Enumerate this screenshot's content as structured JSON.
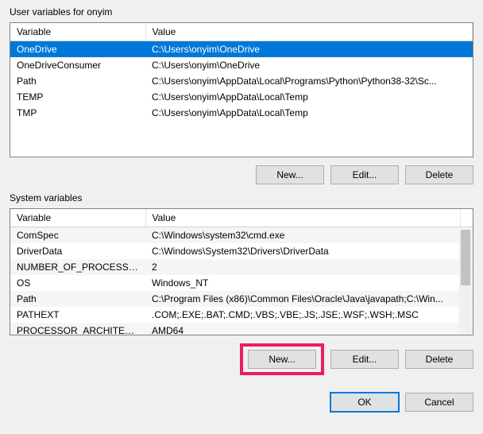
{
  "user_section": {
    "label": "User variables for onyim",
    "columns": {
      "variable": "Variable",
      "value": "Value"
    },
    "rows": [
      {
        "variable": "OneDrive",
        "value": "C:\\Users\\onyim\\OneDrive",
        "selected": true
      },
      {
        "variable": "OneDriveConsumer",
        "value": "C:\\Users\\onyim\\OneDrive",
        "selected": false
      },
      {
        "variable": "Path",
        "value": "C:\\Users\\onyim\\AppData\\Local\\Programs\\Python\\Python38-32\\Sc...",
        "selected": false
      },
      {
        "variable": "TEMP",
        "value": "C:\\Users\\onyim\\AppData\\Local\\Temp",
        "selected": false
      },
      {
        "variable": "TMP",
        "value": "C:\\Users\\onyim\\AppData\\Local\\Temp",
        "selected": false
      }
    ],
    "buttons": {
      "new": "New...",
      "edit": "Edit...",
      "delete": "Delete"
    }
  },
  "system_section": {
    "label": "System variables",
    "columns": {
      "variable": "Variable",
      "value": "Value"
    },
    "rows": [
      {
        "variable": "ComSpec",
        "value": "C:\\Windows\\system32\\cmd.exe"
      },
      {
        "variable": "DriverData",
        "value": "C:\\Windows\\System32\\Drivers\\DriverData"
      },
      {
        "variable": "NUMBER_OF_PROCESSORS",
        "value": "2"
      },
      {
        "variable": "OS",
        "value": "Windows_NT"
      },
      {
        "variable": "Path",
        "value": "C:\\Program Files (x86)\\Common Files\\Oracle\\Java\\javapath;C:\\Win..."
      },
      {
        "variable": "PATHEXT",
        "value": ".COM;.EXE;.BAT;.CMD;.VBS;.VBE;.JS;.JSE;.WSF;.WSH;.MSC"
      },
      {
        "variable": "PROCESSOR_ARCHITECTURE",
        "value": "AMD64"
      }
    ],
    "buttons": {
      "new": "New...",
      "edit": "Edit...",
      "delete": "Delete"
    }
  },
  "dialog_buttons": {
    "ok": "OK",
    "cancel": "Cancel"
  }
}
